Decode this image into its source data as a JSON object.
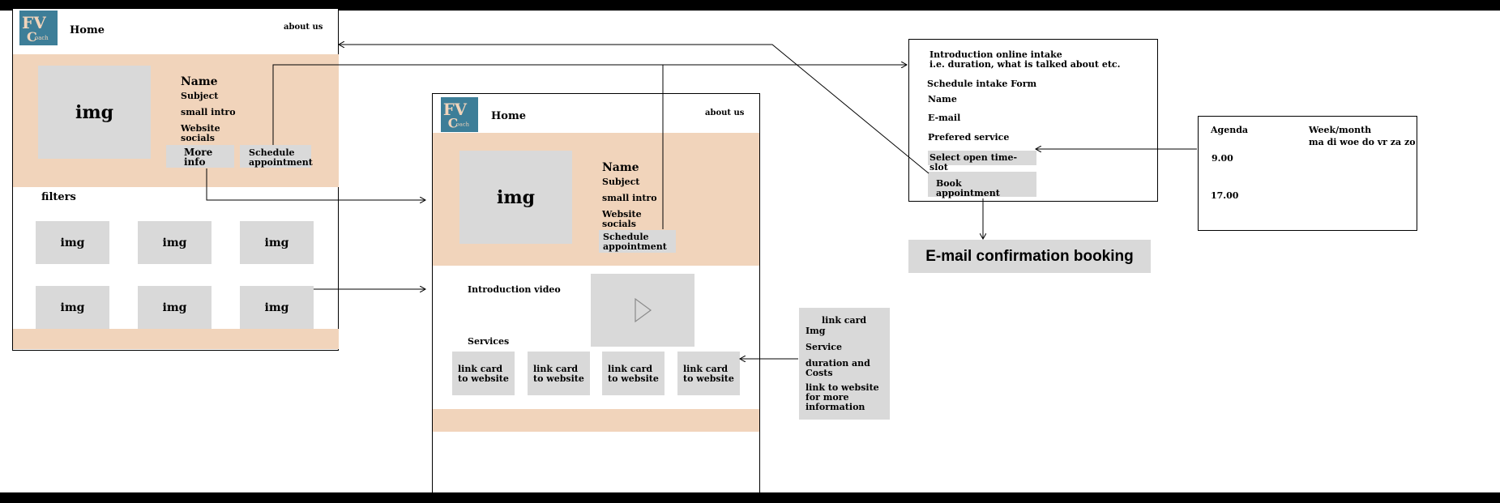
{
  "pageA": {
    "nav_home": "Home",
    "nav_about": "about us",
    "hero_img": "img",
    "name": "Name",
    "subject": "Subject",
    "intro": "small intro",
    "website": "Website\nsocials",
    "more_info": "More\ninfo",
    "schedule": "Schedule\nappointment",
    "filters": "filters",
    "grid": [
      "img",
      "img",
      "img",
      "img",
      "img",
      "img"
    ]
  },
  "pageB": {
    "nav_home": "Home",
    "nav_about": "about us",
    "hero_img": "img",
    "name": "Name",
    "subject": "Subject",
    "intro": "small intro",
    "website": "Website\nsocials",
    "schedule": "Schedule\nappointment",
    "intro_video": "Introduction video",
    "services": "Services",
    "cards": [
      "link card\nto website",
      "link card\nto website",
      "link card\nto website",
      "link card\nto website"
    ]
  },
  "linkcard": {
    "title": "link card",
    "img": "Img",
    "service": "Service",
    "duration": "duration and\nCosts",
    "link": "link to website\nfor more\ninformation"
  },
  "intake": {
    "heading": "Introduction online intake\ni.e. duration, what is talked about etc.",
    "form_title": "Schedule intake Form",
    "name": "Name",
    "email": "E-mail",
    "service": "Prefered service",
    "timeslot": "Select open time-slot",
    "book": "Book appointment"
  },
  "confirmation": "E-mail confirmation booking",
  "agenda": {
    "title": "Agenda",
    "period": "Week/month",
    "days": "ma di woe do vr za zo",
    "time_start": "9.00",
    "time_end": "17.00"
  },
  "colors": {
    "background": "#000000",
    "frame": "#ffffff",
    "peach": "#f1d4bb",
    "placeholder_grey": "#d9d9d9",
    "logo_blue": "#3d7e98",
    "logo_letters": "#f1d4bb"
  },
  "logo_text": "FV Coach"
}
